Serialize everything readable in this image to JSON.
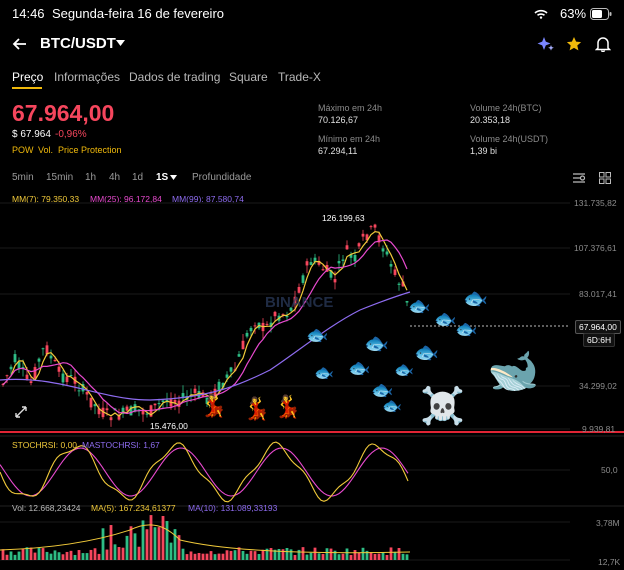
{
  "status": {
    "time": "14:46",
    "date": "Segunda-feira 16 de fevereiro",
    "battery": "63%"
  },
  "header": {
    "pair": "BTC/USDT"
  },
  "tabs": [
    "Preço",
    "Informações",
    "Dados de trading",
    "Square",
    "Trade-X"
  ],
  "price": {
    "last": "67.964,00",
    "usd": "$ 67.964",
    "change": "-0,96%",
    "flags": [
      "POW",
      "Vol.",
      "Price Protection"
    ]
  },
  "stats": {
    "high_label": "Máximo em 24h",
    "high": "70.126,67",
    "low_label": "Mínimo em 24h",
    "low": "67.294,11",
    "vol_btc_label": "Volume 24h(BTC)",
    "vol_btc": "20.353,18",
    "vol_usdt_label": "Volume 24h(USDT)",
    "vol_usdt": "1,39 bi"
  },
  "timeframes": [
    "5min",
    "15min",
    "1h",
    "4h",
    "1d",
    "1S",
    "Profundidade"
  ],
  "selected_timeframe": "1S",
  "ma_legend": {
    "ma7": "MM(7): 79.350,33",
    "ma25": "MM(25): 96.172,84",
    "ma99": "MM(99): 87.580,74"
  },
  "price_axis": [
    "131.735,82",
    "107.376,61",
    "83.017,41",
    "34.299,02",
    "9.939,81"
  ],
  "current_price_tag": "67.964,00",
  "countdown_tag": "6D:6H",
  "chart_marks": {
    "high": "126.199,63",
    "low": "15.476,00"
  },
  "stoch": {
    "label": "STOCHRSI: 0,00",
    "ma_label": "MASTOCHRSI: 1,67",
    "axis": "50,0"
  },
  "volume": {
    "vol": "Vol: 12.668,23424",
    "ma5": "MA(5): 167.234,61377",
    "ma10": "MA(10): 131.089,33193",
    "axis_top": "3,78M",
    "axis_bottom": "12,7K"
  },
  "watermark": "BINANCE",
  "colors": {
    "up": "#2ebd85",
    "down": "#f6465d",
    "ma7": "#f0c93a",
    "ma25": "#e84acf",
    "ma99": "#8e6cf0",
    "accent": "#f0b90b"
  }
}
